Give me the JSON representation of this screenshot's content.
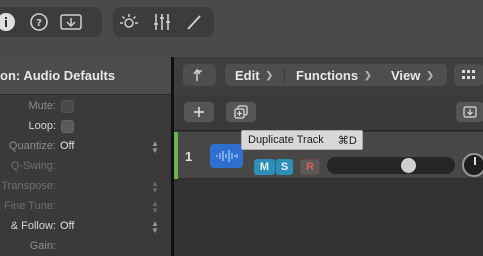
{
  "toolbar": {
    "icons": [
      "info-icon",
      "help-icon",
      "download-icon",
      "brightness-icon",
      "mixer-icon",
      "pencil-icon"
    ]
  },
  "inspector": {
    "title": "on: Audio Defaults",
    "rows": [
      {
        "label": "Mute:",
        "type": "checkbox"
      },
      {
        "label": "Loop:",
        "type": "checkbox"
      },
      {
        "label": "Quantize:",
        "value": "Off"
      },
      {
        "label": "Q-Swing:"
      },
      {
        "label": "Transpose:"
      },
      {
        "label": "Fine Tune:"
      },
      {
        "label": "& Follow:",
        "value": "Off"
      },
      {
        "label": "Gain:"
      }
    ]
  },
  "menubar": {
    "edit": "Edit",
    "functions": "Functions",
    "view": "View"
  },
  "tooltip": {
    "text": "Duplicate Track",
    "shortcut": "⌘D"
  },
  "track": {
    "number": "1",
    "mute": "M",
    "solo": "S",
    "record": "R",
    "volume": 0.66,
    "color": "#6bb34a"
  }
}
